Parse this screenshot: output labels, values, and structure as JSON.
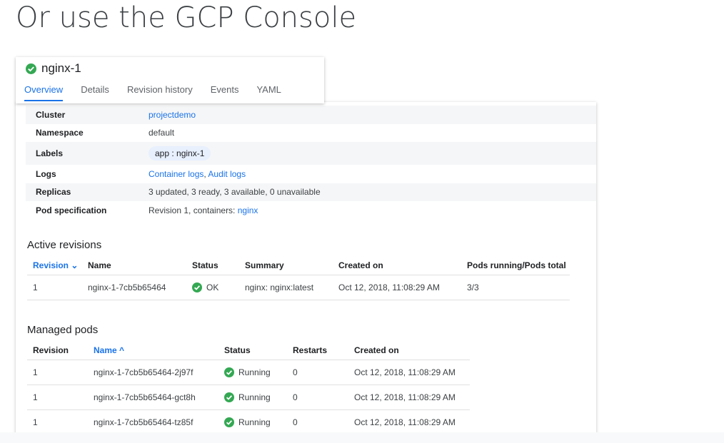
{
  "slide": {
    "title": "Or use the GCP Console"
  },
  "header": {
    "name": "nginx-1",
    "tabs": [
      "Overview",
      "Details",
      "Revision history",
      "Events",
      "YAML"
    ],
    "active_tab": "Overview"
  },
  "properties": {
    "cluster": {
      "label": "Cluster",
      "value": "projectdemo"
    },
    "namespace": {
      "label": "Namespace",
      "value": "default"
    },
    "labels": {
      "label": "Labels",
      "value": "app : nginx-1"
    },
    "logs": {
      "label": "Logs",
      "links": [
        "Container logs",
        "Audit logs"
      ],
      "separator": ", "
    },
    "replicas": {
      "label": "Replicas",
      "value": "3 updated, 3 ready, 3 available, 0 unavailable"
    },
    "pod_spec": {
      "label": "Pod specification",
      "prefix": "Revision 1, containers: ",
      "link": "nginx"
    }
  },
  "active_revisions": {
    "title": "Active revisions",
    "columns": [
      "Revision",
      "Name",
      "Status",
      "Summary",
      "Created on",
      "Pods running/Pods total"
    ],
    "sort_indicator": "⌄",
    "rows": [
      {
        "revision": "1",
        "name": "nginx-1-7cb5b65464",
        "status": "OK",
        "summary": "nginx: nginx:latest",
        "created": "Oct 12, 2018, 11:08:29 AM",
        "pods": "3/3"
      }
    ]
  },
  "managed_pods": {
    "title": "Managed pods",
    "columns": [
      "Revision",
      "Name",
      "Status",
      "Restarts",
      "Created on"
    ],
    "sort_indicator": "^",
    "rows": [
      {
        "revision": "1",
        "name": "nginx-1-7cb5b65464-2j97f",
        "status": "Running",
        "restarts": "0",
        "created": "Oct 12, 2018, 11:08:29 AM"
      },
      {
        "revision": "1",
        "name": "nginx-1-7cb5b65464-gct8h",
        "status": "Running",
        "restarts": "0",
        "created": "Oct 12, 2018, 11:08:29 AM"
      },
      {
        "revision": "1",
        "name": "nginx-1-7cb5b65464-tz85f",
        "status": "Running",
        "restarts": "0",
        "created": "Oct 12, 2018, 11:08:29 AM"
      }
    ]
  },
  "colors": {
    "accent": "#1a73e8",
    "success": "#34a853",
    "chip": "#e8f0fe"
  }
}
